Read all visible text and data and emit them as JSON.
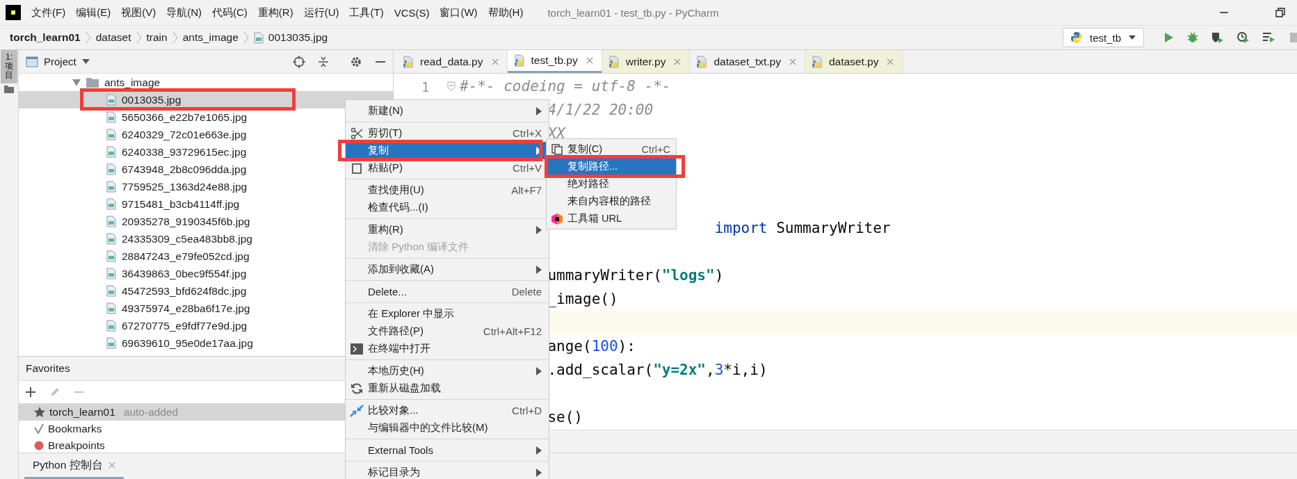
{
  "title_bar": {
    "menu": [
      "文件(F)",
      "编辑(E)",
      "视图(V)",
      "导航(N)",
      "代码(C)",
      "重构(R)",
      "运行(U)",
      "工具(T)",
      "VCS(S)",
      "窗口(W)",
      "帮助(H)"
    ],
    "title": "torch_learn01 - test_tb.py - PyCharm"
  },
  "breadcrumb": [
    {
      "label": "torch_learn01",
      "kind": "project"
    },
    {
      "label": "dataset",
      "kind": "folder"
    },
    {
      "label": "train",
      "kind": "folder"
    },
    {
      "label": "ants_image",
      "kind": "folder"
    },
    {
      "label": "0013035.jpg",
      "kind": "image"
    }
  ],
  "run_config": {
    "label": "test_tb"
  },
  "side_strip": {
    "label": "1:项目",
    "selected": true
  },
  "project_panel": {
    "title": "Project",
    "tree": [
      {
        "label": "ants_image",
        "kind": "folder",
        "expanded": true,
        "selected": false,
        "children": [
          {
            "label": "0013035.jpg",
            "kind": "image",
            "selected": true
          },
          {
            "label": "5650366_e22b7e1065.jpg",
            "kind": "image",
            "selected": false
          },
          {
            "label": "6240329_72c01e663e.jpg",
            "kind": "image",
            "selected": false
          },
          {
            "label": "6240338_93729615ec.jpg",
            "kind": "image",
            "selected": false
          },
          {
            "label": "6743948_2b8c096dda.jpg",
            "kind": "image",
            "selected": false
          },
          {
            "label": "7759525_1363d24e88.jpg",
            "kind": "image",
            "selected": false
          },
          {
            "label": "9715481_b3cb4114ff.jpg",
            "kind": "image",
            "selected": false
          },
          {
            "label": "20935278_9190345f6b.jpg",
            "kind": "image",
            "selected": false
          },
          {
            "label": "24335309_c5ea483bb8.jpg",
            "kind": "image",
            "selected": false
          },
          {
            "label": "28847243_e79fe052cd.jpg",
            "kind": "image",
            "selected": false
          },
          {
            "label": "36439863_0bec9f554f.jpg",
            "kind": "image",
            "selected": false
          },
          {
            "label": "45472593_bfd624f8dc.jpg",
            "kind": "image",
            "selected": false
          },
          {
            "label": "49375974_e28ba6f17e.jpg",
            "kind": "image",
            "selected": false
          },
          {
            "label": "67270775_e9fdf77e9d.jpg",
            "kind": "image",
            "selected": false
          },
          {
            "label": "69639610_95e0de17aa.jpg",
            "kind": "image",
            "selected": false
          }
        ]
      }
    ]
  },
  "favorites": {
    "title": "Favorites",
    "items": [
      {
        "label": "torch_learn01",
        "note": "auto-added",
        "kind": "project",
        "selected": true
      },
      {
        "label": "Bookmarks",
        "kind": "bookmarks",
        "selected": false
      },
      {
        "label": "Breakpoints",
        "kind": "breakpoints",
        "selected": false
      }
    ]
  },
  "editor": {
    "tabs": [
      {
        "label": "read_data.py",
        "selected": false,
        "tinted": false
      },
      {
        "label": "test_tb.py",
        "selected": true,
        "tinted": false
      },
      {
        "label": "writer.py",
        "selected": false,
        "tinted": true
      },
      {
        "label": "dataset_txt.py",
        "selected": false,
        "tinted": false
      },
      {
        "label": "dataset.py",
        "selected": false,
        "tinted": true
      }
    ],
    "line_numbers": [
      "1"
    ],
    "lines": [
      {
        "kind": "full",
        "segments": [
          {
            "t": "#-*- codeing = utf-8 -*-",
            "kind": "comment"
          }
        ]
      },
      {
        "kind": "clipped",
        "segments": [
          {
            "t": "4/1/22 20:00",
            "kind": "comment"
          }
        ]
      },
      {
        "kind": "clipped",
        "segments": [
          {
            "t": "XX",
            "kind": "comment"
          }
        ]
      },
      {
        "kind": "blank"
      },
      {
        "kind": "blank"
      },
      {
        "kind": "blank"
      },
      {
        "kind": "covered",
        "segments": [
          {
            "t": "import",
            "kind": "keyword"
          },
          {
            "t": " SummaryWriter",
            "kind": "plain"
          }
        ]
      },
      {
        "kind": "blank"
      },
      {
        "kind": "clipped",
        "segments": [
          {
            "t": "ummaryWriter(",
            "kind": "plain"
          },
          {
            "t": "\"logs\"",
            "kind": "string"
          },
          {
            "t": ")",
            "kind": "plain"
          }
        ]
      },
      {
        "kind": "clipped",
        "segments": [
          {
            "t": "_image()",
            "kind": "plain"
          }
        ]
      },
      {
        "kind": "current"
      },
      {
        "kind": "clipped",
        "segments": [
          {
            "t": "ange(",
            "kind": "plain"
          },
          {
            "t": "100",
            "kind": "number"
          },
          {
            "t": "):",
            "kind": "plain"
          }
        ]
      },
      {
        "kind": "clipped",
        "segments": [
          {
            "t": ".add_scalar(",
            "kind": "plain"
          },
          {
            "t": "\"y=2x\"",
            "kind": "string"
          },
          {
            "t": ",",
            "kind": "plain"
          },
          {
            "t": "3",
            "kind": "number"
          },
          {
            "t": "*i,i)",
            "kind": "plain"
          }
        ]
      },
      {
        "kind": "blank"
      },
      {
        "kind": "clipped",
        "segments": [
          {
            "t": "se()",
            "kind": "plain"
          }
        ]
      }
    ]
  },
  "bottom_tabs": [
    {
      "label": "Python 控制台",
      "selected": true
    }
  ],
  "context_menu": {
    "items": [
      {
        "label": "新建(N)",
        "kind": "plain",
        "submenu": true,
        "selected": false,
        "disabled": false,
        "separator_after": true
      },
      {
        "label": "剪切(T)",
        "shortcut": "Ctrl+X",
        "kind": "scissors",
        "submenu": false,
        "selected": false,
        "disabled": false,
        "separator_after": false
      },
      {
        "label": "复制",
        "kind": "plain",
        "submenu": true,
        "selected": true,
        "disabled": false,
        "separator_after": false
      },
      {
        "label": "粘贴(P)",
        "shortcut": "Ctrl+V",
        "kind": "clipboard",
        "submenu": false,
        "selected": false,
        "disabled": false,
        "separator_after": true
      },
      {
        "label": "查找使用(U)",
        "shortcut": "Alt+F7",
        "kind": "plain",
        "submenu": false,
        "selected": false,
        "disabled": false,
        "separator_after": false
      },
      {
        "label": "检查代码...(I)",
        "kind": "plain",
        "submenu": false,
        "selected": false,
        "disabled": false,
        "separator_after": true
      },
      {
        "label": "重构(R)",
        "kind": "plain",
        "submenu": true,
        "selected": false,
        "disabled": false,
        "separator_after": false
      },
      {
        "label": "清除 Python 编译文件",
        "kind": "plain",
        "submenu": false,
        "selected": false,
        "disabled": true,
        "separator_after": true
      },
      {
        "label": "添加到收藏(A)",
        "kind": "plain",
        "submenu": true,
        "selected": false,
        "disabled": false,
        "separator_after": true
      },
      {
        "label": "Delete...",
        "shortcut": "Delete",
        "kind": "plain",
        "submenu": false,
        "selected": false,
        "disabled": false,
        "separator_after": true
      },
      {
        "label": "在 Explorer 中显示",
        "kind": "plain",
        "submenu": false,
        "selected": false,
        "disabled": false,
        "separator_after": false
      },
      {
        "label": "文件路径(P)",
        "shortcut": "Ctrl+Alt+F12",
        "kind": "plain",
        "submenu": false,
        "selected": false,
        "disabled": false,
        "separator_after": false
      },
      {
        "label": "在终端中打开",
        "kind": "terminal",
        "submenu": false,
        "selected": false,
        "disabled": false,
        "separator_after": true
      },
      {
        "label": "本地历史(H)",
        "kind": "plain",
        "submenu": true,
        "selected": false,
        "disabled": false,
        "separator_after": false
      },
      {
        "label": "重新从磁盘加载",
        "kind": "reload",
        "submenu": false,
        "selected": false,
        "disabled": false,
        "separator_after": true
      },
      {
        "label": "比较对象...",
        "shortcut": "Ctrl+D",
        "kind": "compare",
        "submenu": false,
        "selected": false,
        "disabled": false,
        "separator_after": false
      },
      {
        "label": "与编辑器中的文件比较(M)",
        "kind": "plain",
        "submenu": false,
        "selected": false,
        "disabled": false,
        "separator_after": true
      },
      {
        "label": "External Tools",
        "kind": "plain",
        "submenu": true,
        "selected": false,
        "disabled": false,
        "separator_after": true
      },
      {
        "label": "标记目录为",
        "kind": "plain",
        "submenu": true,
        "selected": false,
        "disabled": false,
        "separator_after": false
      }
    ]
  },
  "submenu": {
    "items": [
      {
        "label": "复制(C)",
        "shortcut": "Ctrl+C",
        "kind": "copy",
        "selected": false
      },
      {
        "label": "复制路径...",
        "kind": "plain",
        "selected": true
      },
      {
        "label": "绝对路径",
        "kind": "plain",
        "selected": false
      },
      {
        "label": "来自内容根的路径",
        "kind": "plain",
        "selected": false
      },
      {
        "label": "工具箱 URL",
        "kind": "toolbox",
        "selected": false
      }
    ]
  }
}
